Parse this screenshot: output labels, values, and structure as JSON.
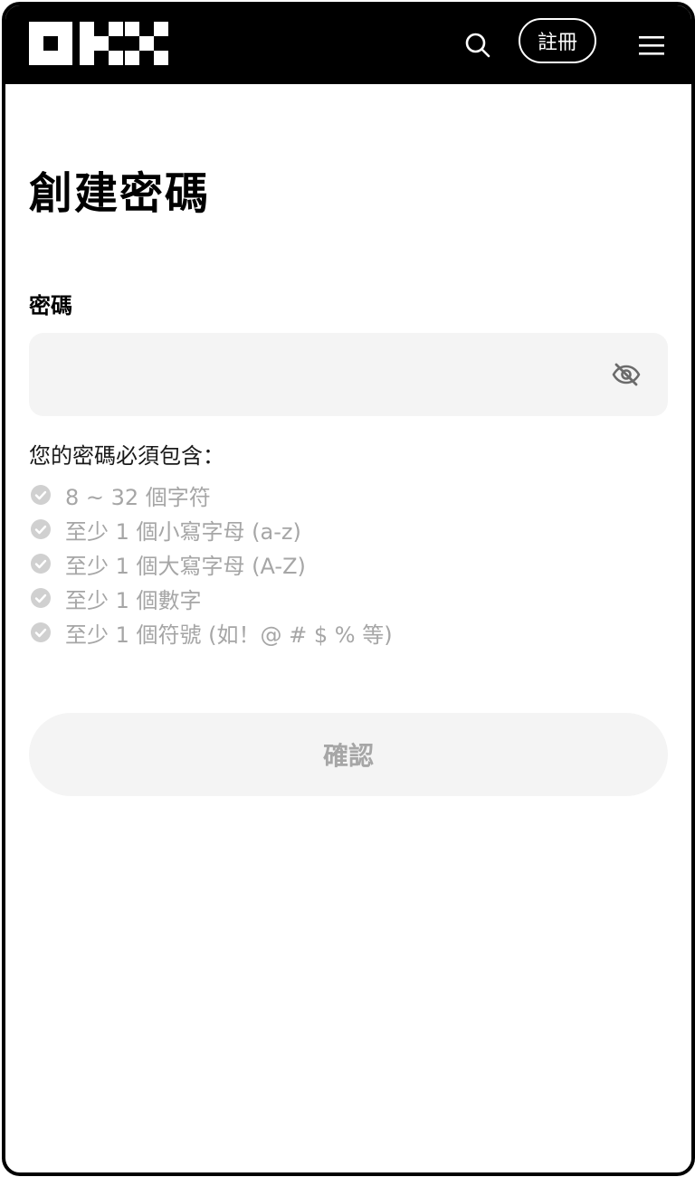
{
  "header": {
    "logo_icon": "okx-logo",
    "search_icon": "search-icon",
    "register_label": "註冊",
    "menu_icon": "hamburger-menu-icon"
  },
  "page": {
    "title": "創建密碼"
  },
  "password_field": {
    "label": "密碼",
    "value": "",
    "placeholder": "",
    "visibility_icon": "eye-slash-icon"
  },
  "requirements": {
    "heading": "您的密碼必須包含：",
    "items": [
      {
        "label": "8 ~ 32 個字符",
        "met": false
      },
      {
        "label": "至少 1 個小寫字母 (a-z)",
        "met": false
      },
      {
        "label": "至少 1 個大寫字母 (A-Z)",
        "met": false
      },
      {
        "label": "至少 1 個數字",
        "met": false
      },
      {
        "label": "至少 1 個符號 (如！@ # $ % 等)",
        "met": false
      }
    ]
  },
  "confirm": {
    "label": "確認",
    "enabled": false
  },
  "colors": {
    "header_bg": "#000000",
    "input_bg": "#f4f4f4",
    "muted_text": "#a6a6a6",
    "check_circle": "#d0d0d0"
  }
}
